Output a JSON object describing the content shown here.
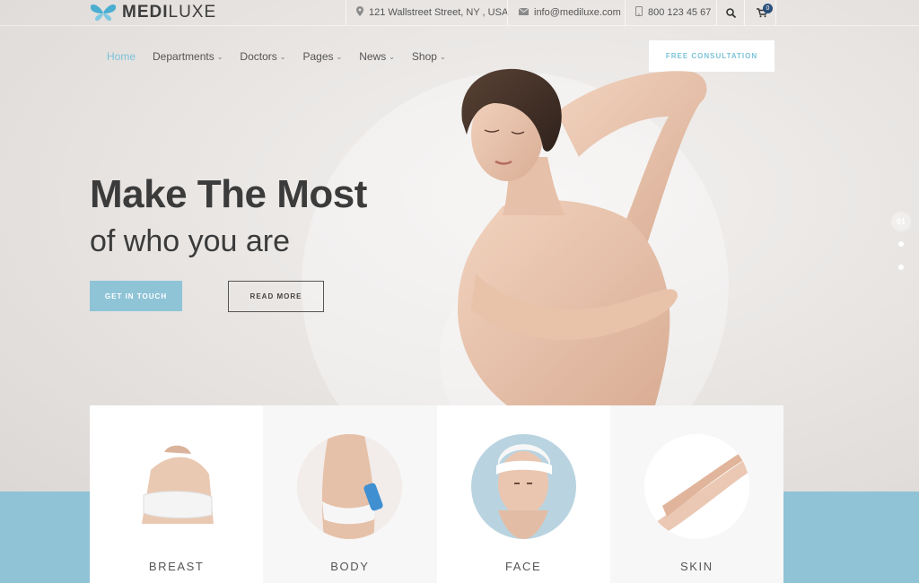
{
  "brand": {
    "name_bold": "MEDI",
    "name_light": "LUXE",
    "accent": "#7cc3d9"
  },
  "topbar": {
    "address": "121 Wallstreet Street, NY , USA",
    "email": "info@mediluxe.com",
    "phone": "800 123 45 67",
    "cart_count": "0"
  },
  "nav": {
    "items": [
      {
        "label": "Home",
        "active": true
      },
      {
        "label": "Departments",
        "dropdown": true
      },
      {
        "label": "Doctors",
        "dropdown": true
      },
      {
        "label": "Pages",
        "dropdown": true
      },
      {
        "label": "News",
        "dropdown": true
      },
      {
        "label": "Shop",
        "dropdown": true
      }
    ],
    "cta": "FREE CONSULTATION"
  },
  "hero": {
    "title": "Make The Most",
    "subtitle": "of who you are",
    "primary_button": "GET IN TOUCH",
    "secondary_button": "READ MORE",
    "slide_number": "01"
  },
  "departments": [
    {
      "label": "BREAST"
    },
    {
      "label": "BODY"
    },
    {
      "label": "FACE"
    },
    {
      "label": "SKIN"
    }
  ],
  "colors": {
    "primary_button": "#8fc4d7",
    "band": "#90c3d6",
    "cart_badge": "#2a4f7a"
  }
}
